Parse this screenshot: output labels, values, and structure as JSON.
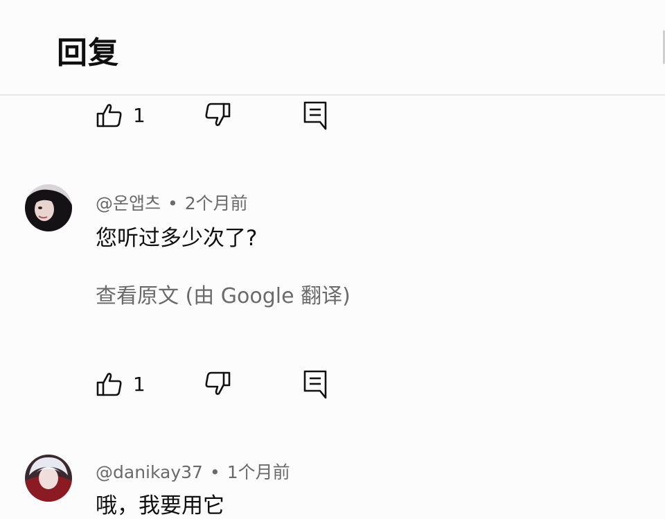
{
  "header": {
    "title": "回复"
  },
  "top_actions": {
    "like_count": "1"
  },
  "comments": [
    {
      "author": "@온앱츠",
      "separator": "•",
      "time": "2个月前",
      "text": "您听过多少次了?",
      "translate_label": "查看原文 (由 Google 翻译)",
      "like_count": "1"
    },
    {
      "author": "@danikay37",
      "separator": "•",
      "time": "1个月前",
      "text": "哦，我要用它"
    }
  ],
  "colors": {
    "background": "#fdfcfd",
    "primary_text": "#0f0f0f",
    "secondary_text": "#6a6a6a",
    "divider": "#e6e6e6"
  },
  "icons": [
    "like-icon",
    "dislike-icon",
    "reply-icon"
  ]
}
